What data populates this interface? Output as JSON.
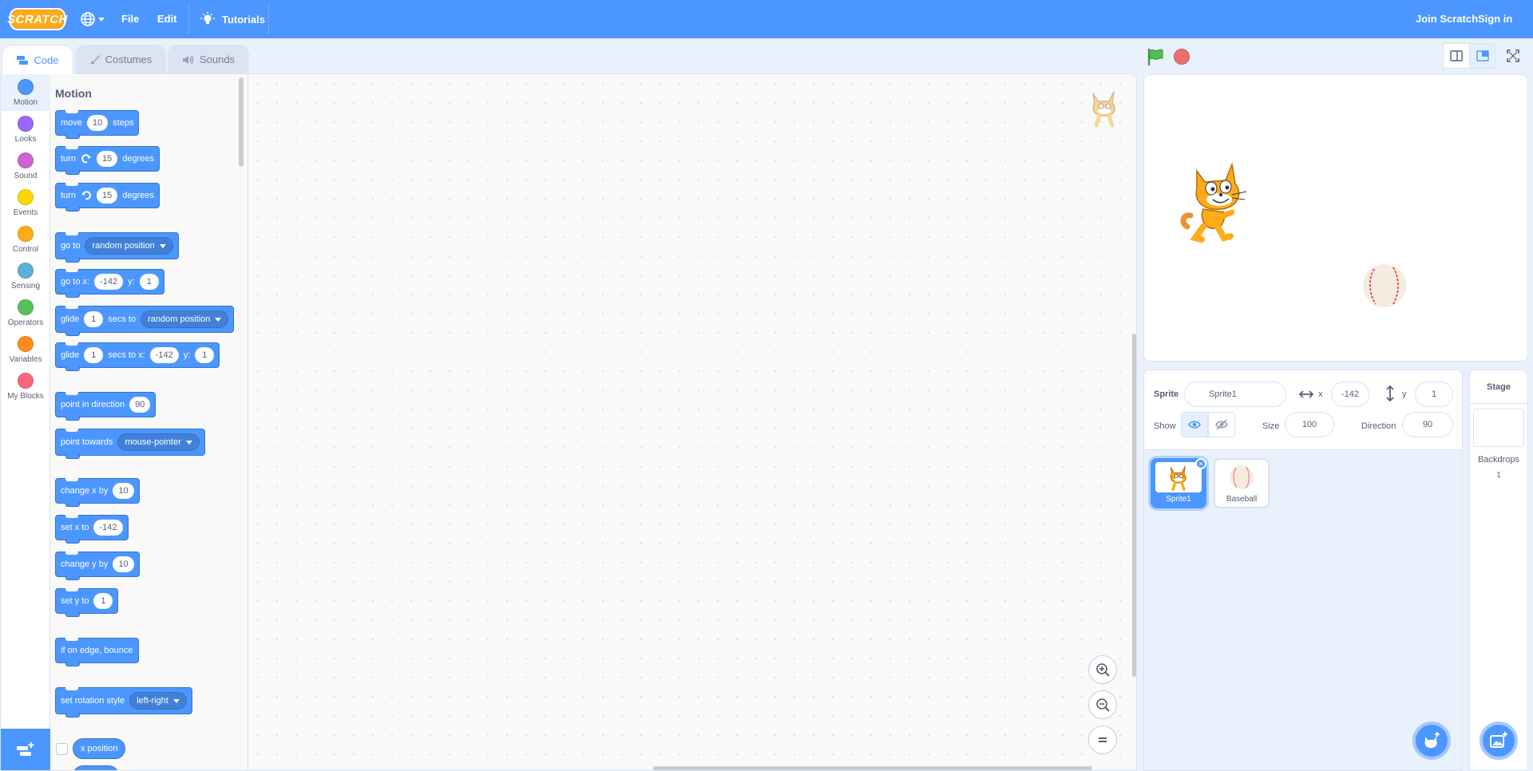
{
  "menu": {
    "logo": "SCRATCH",
    "file": "File",
    "edit": "Edit",
    "tutorials": "Tutorials",
    "join": "Join Scratch",
    "sign_in": "Sign in"
  },
  "tabs": {
    "code": "Code",
    "costumes": "Costumes",
    "sounds": "Sounds"
  },
  "categories": [
    {
      "label": "Motion",
      "color": "#4c97ff"
    },
    {
      "label": "Looks",
      "color": "#9966ff"
    },
    {
      "label": "Sound",
      "color": "#cf63cf"
    },
    {
      "label": "Events",
      "color": "#ffd500"
    },
    {
      "label": "Control",
      "color": "#ffab19"
    },
    {
      "label": "Sensing",
      "color": "#5cb1d6"
    },
    {
      "label": "Operators",
      "color": "#59c059"
    },
    {
      "label": "Variables",
      "color": "#ff8c1a"
    },
    {
      "label": "My Blocks",
      "color": "#ff6680"
    }
  ],
  "palette": {
    "title": "Motion",
    "move": {
      "a": "move",
      "n": "10",
      "b": "steps"
    },
    "turn_right": {
      "a": "turn",
      "n": "15",
      "b": "degrees"
    },
    "turn_left": {
      "a": "turn",
      "n": "15",
      "b": "degrees"
    },
    "goto": {
      "a": "go to",
      "d": "random position"
    },
    "goto_xy": {
      "a": "go to x:",
      "x": "-142",
      "b": "y:",
      "y": "1"
    },
    "glide_to": {
      "a": "glide",
      "n": "1",
      "b": "secs to",
      "d": "random position"
    },
    "glide_xy": {
      "a": "glide",
      "n": "1",
      "b": "secs to x:",
      "x": "-142",
      "c": "y:",
      "y": "1"
    },
    "point_dir": {
      "a": "point in direction",
      "n": "90"
    },
    "point_towards": {
      "a": "point towards",
      "d": "mouse-pointer"
    },
    "change_x": {
      "a": "change x by",
      "n": "10"
    },
    "set_x": {
      "a": "set x to",
      "n": "-142"
    },
    "change_y": {
      "a": "change y by",
      "n": "10"
    },
    "set_y": {
      "a": "set y to",
      "n": "1"
    },
    "bounce": {
      "a": "if on edge, bounce"
    },
    "rotation_style": {
      "a": "set rotation style",
      "d": "left-right"
    },
    "x_position": "x position"
  },
  "sprite_info": {
    "sprite_label": "Sprite",
    "sprite_name": "Sprite1",
    "x_label": "x",
    "x": "-142",
    "y_label": "y",
    "y": "1",
    "show_label": "Show",
    "size_label": "Size",
    "size": "100",
    "direction_label": "Direction",
    "direction": "90"
  },
  "sprites": [
    {
      "name": "Sprite1",
      "selected": true
    },
    {
      "name": "Baseball",
      "selected": false
    }
  ],
  "stage_pane": {
    "title": "Stage",
    "backdrops_label": "Backdrops",
    "backdrops_count": "1"
  },
  "colors": {
    "accent": "#4c97ff",
    "menu_bar": "#4c97ff",
    "stop": "#ec5959",
    "flag": "#4cbf56"
  }
}
